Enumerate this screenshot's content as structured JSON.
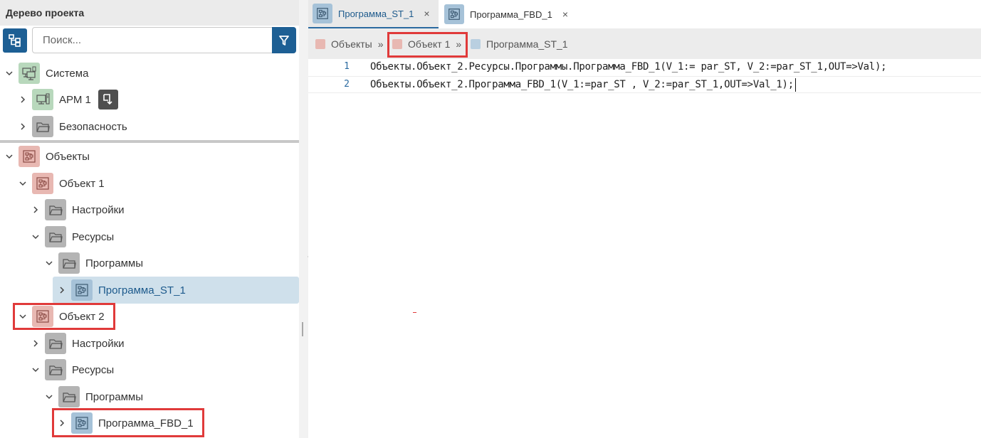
{
  "left_panel": {
    "title": "Дерево проекта",
    "search": {
      "placeholder": "Поиск...",
      "value": ""
    },
    "tree": {
      "system": "Система",
      "arm": "АРМ 1",
      "security": "Безопасность",
      "objects": "Объекты",
      "obj1": {
        "label": "Объект 1",
        "settings": "Настройки",
        "resources": "Ресурсы",
        "programs": "Программы",
        "program": "Программа_ST_1"
      },
      "obj2": {
        "label": "Объект 2",
        "settings": "Настройки",
        "resources": "Ресурсы",
        "programs": "Программы",
        "program": "Программа_FBD_1"
      }
    }
  },
  "tabs": [
    {
      "label": "Программа_ST_1",
      "active": true,
      "close": "×"
    },
    {
      "label": "Программа_FBD_1",
      "active": false,
      "close": "×"
    }
  ],
  "breadcrumb": {
    "items": [
      "Объекты",
      "Объект 1",
      "Программа_ST_1"
    ],
    "separator": "»"
  },
  "editor": {
    "lines": [
      {
        "number": "1",
        "text": "Объекты.Объект_2.Ресурсы.Программы.Программа_FBD_1(V_1:= par_ST, V_2:=par_ST_1,OUT=>Val);"
      },
      {
        "number": "2",
        "text": "Объекты.Объект_2.Программа_FBD_1(V_1:=par_ST , V_2:=par_ST_1,OUT=>Val_1);"
      }
    ]
  },
  "colors": {
    "accent": "#1d5f94",
    "highlight": "#e03a3a",
    "selection": "#cfe0eb",
    "folder_icon": "#b4b4b4",
    "object_icon": "#e8b8b2",
    "system_icon": "#b8d8bc",
    "program_icon": "#a6c2d8"
  }
}
